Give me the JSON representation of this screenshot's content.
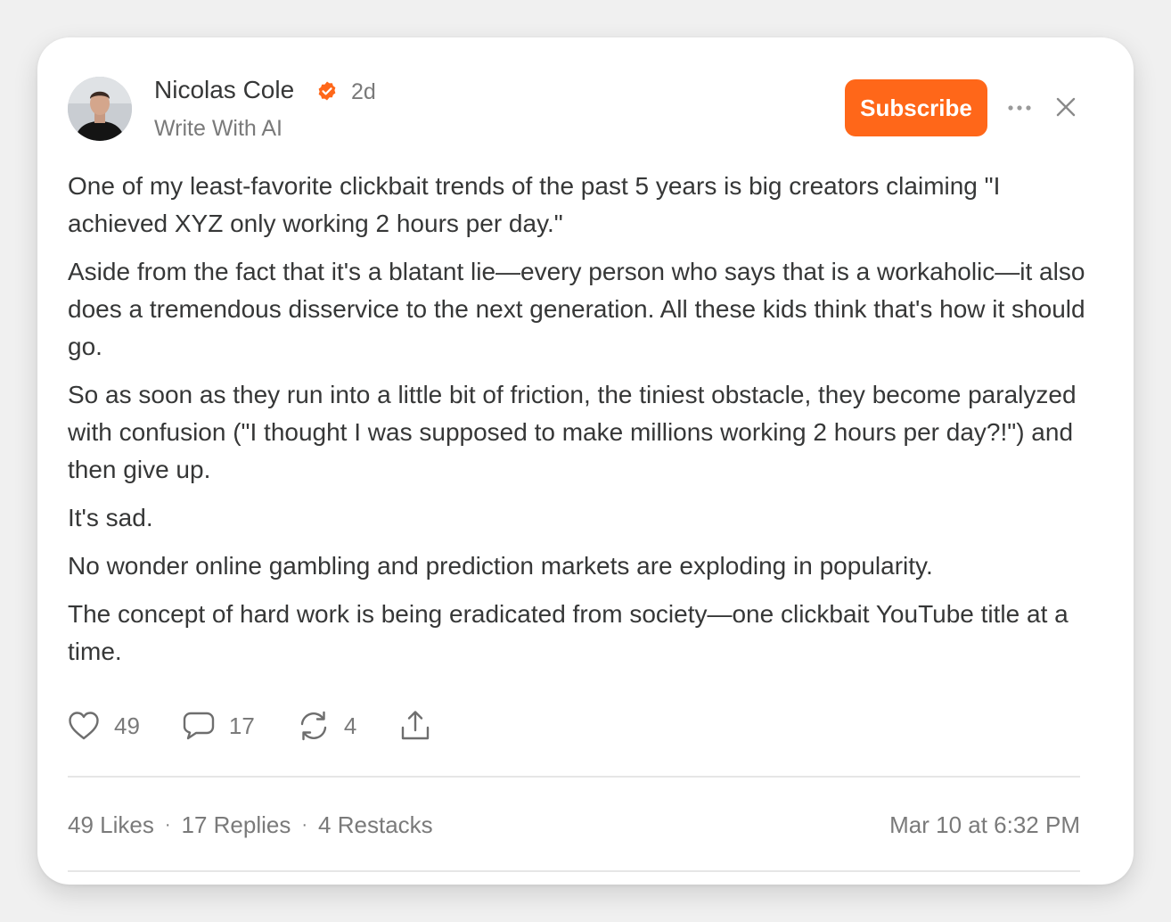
{
  "post": {
    "author": "Nicolas Cole",
    "time_ago": "2d",
    "publication": "Write With AI",
    "subscribe_label": "Subscribe",
    "paragraphs": [
      "One of my least-favorite clickbait trends of the past 5 years is big creators claiming \"I achieved XYZ only working 2 hours per day.\"",
      "Aside from the fact that it's a blatant lie—every person who says that is a workaholic—it also does a tremendous disservice to the next generation. All these kids think that's how it should go.",
      "So as soon as they run into a little bit of friction, the tiniest obstacle, they become paralyzed with confusion (\"I thought I was supposed to make millions working 2 hours per day?!\") and then give up.",
      "It's sad.",
      "No wonder online gambling and prediction markets are exploding in popularity.",
      "The concept of hard work is being eradicated from society—one clickbait YouTube title at a time."
    ],
    "actions": {
      "likes": "49",
      "comments": "17",
      "restacks": "4"
    },
    "stats": {
      "likes": "49 Likes",
      "replies": "17 Replies",
      "restacks": "4 Restacks",
      "separator": "·"
    },
    "date": "Mar 10 at 6:32 PM"
  },
  "icons": {
    "verified": "verified-badge-icon",
    "more": "more-dots-icon",
    "close": "close-icon",
    "like": "heart-icon",
    "comment": "comment-bubble-icon",
    "restack": "restack-icon",
    "share": "share-icon"
  },
  "colors": {
    "accent": "#ff6719",
    "text": "#363737",
    "muted": "#7a7a7a"
  }
}
